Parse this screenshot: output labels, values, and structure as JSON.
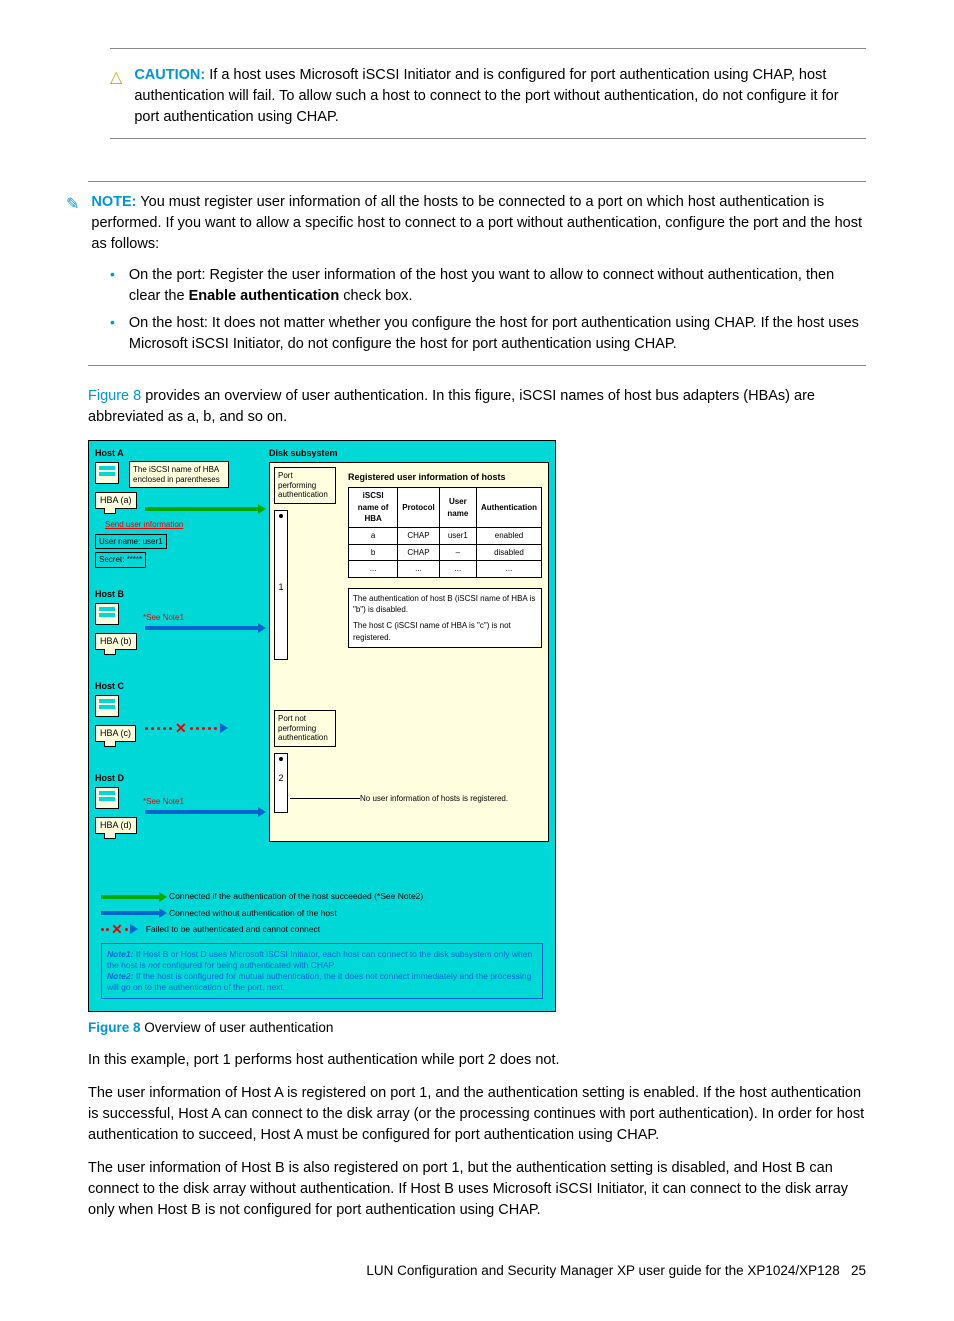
{
  "caution": {
    "label": "CAUTION:",
    "text": "If a host uses Microsoft iSCSI Initiator and is configured for port authentication using CHAP, host authentication will fail. To allow such a host to connect to the port without authentication, do not configure it for port authentication using CHAP."
  },
  "note": {
    "label": "NOTE:",
    "intro": "You must register user information of all the hosts to be connected to a port on which host authentication is performed. If you want to allow a specific host to connect to a port without authentication, configure the port and the host as follows:",
    "bullets": [
      {
        "lead": "On the port: Register the user information of the host you want to allow to connect without authentication, then clear the ",
        "bold": "Enable authentication",
        "tail": " check box."
      },
      {
        "lead": "On the host: It does not matter whether you configure the host for port authentication using CHAP. If the host uses Microsoft iSCSI Initiator, do not configure the host for port authentication using CHAP.",
        "bold": "",
        "tail": ""
      }
    ]
  },
  "intro_para": {
    "link": "Figure 8",
    "text": " provides an overview of user authentication. In this figure, iSCSI names of host bus adapters (HBAs) are abbreviated as a, b, and so on."
  },
  "figure": {
    "hosts": {
      "A": "Host A",
      "B": "Host B",
      "C": "Host C",
      "D": "Host D"
    },
    "hba": {
      "a": "HBA (a)",
      "b": "HBA (b)",
      "c": "HBA (c)",
      "d": "HBA (d)"
    },
    "iscsi_note": "The iSCSI name of HBA enclosed in parentheses",
    "send_info": "Send user information",
    "user_name": "User name: user1",
    "secret": "Secret: *****",
    "see_note1": "*See Note1",
    "disk_subsystem": "Disk subsystem",
    "port1": "Port performing authentication",
    "port2": "Port not performing authentication",
    "port_num_1": "1",
    "port_num_2": "2",
    "reg_title": "Registered user information of hosts",
    "table": {
      "headers": [
        "iSCSI name of HBA",
        "Protocol",
        "User name",
        "Authentication"
      ],
      "rows": [
        [
          "a",
          "CHAP",
          "user1",
          "enabled"
        ],
        [
          "b",
          "CHAP",
          "–",
          "disabled"
        ],
        [
          "...",
          "...",
          "...",
          "..."
        ]
      ]
    },
    "auth_note_b": "The authentication of host B (iSCSI name of HBA is \"b\") is disabled.",
    "auth_note_c": "The host C (iSCSI name of HBA is \"c\") is not registered.",
    "no_user_info": "No user information of hosts is registered.",
    "legend": {
      "l1": "Connected if the authentication of the host succeeded (*See Note2)",
      "l2": "Connected without authentication of the host",
      "l3": "Failed to be authenticated and cannot connect"
    },
    "notes": {
      "n1_lead": "Note1:",
      "n1": " If Host B or Host D uses Microsoft iSCSI Initiator, each host can connect to the disk subsystem only when the host is ",
      "n1_italic": "not",
      "n1_tail": " configured for being authenticated with CHAP.",
      "n2_lead": "Note2:",
      "n2": " If the host is configured for mutual authentication, the it does not connect immediately and the processing will go on to the authentication of the port, next."
    }
  },
  "figure_caption": {
    "label": "Figure 8",
    "text": " Overview of user authentication"
  },
  "p1": "In this example, port 1 performs host authentication while port 2 does not.",
  "p2": "The user information of Host A is registered on port 1, and the authentication setting is enabled. If the host authentication is successful, Host A can connect to the disk array (or the processing continues with port authentication). In order for host authentication to succeed, Host A must be configured for port authentication using CHAP.",
  "p3": "The user information of Host B is also registered on port 1, but the authentication setting is disabled, and Host B can connect to the disk array without authentication. If Host B uses Microsoft iSCSI Initiator, it can connect to the disk array only when Host B is not configured for port authentication using CHAP.",
  "footer": {
    "text": "LUN Configuration and Security Manager XP user guide for the XP1024/XP128",
    "page": "25"
  }
}
